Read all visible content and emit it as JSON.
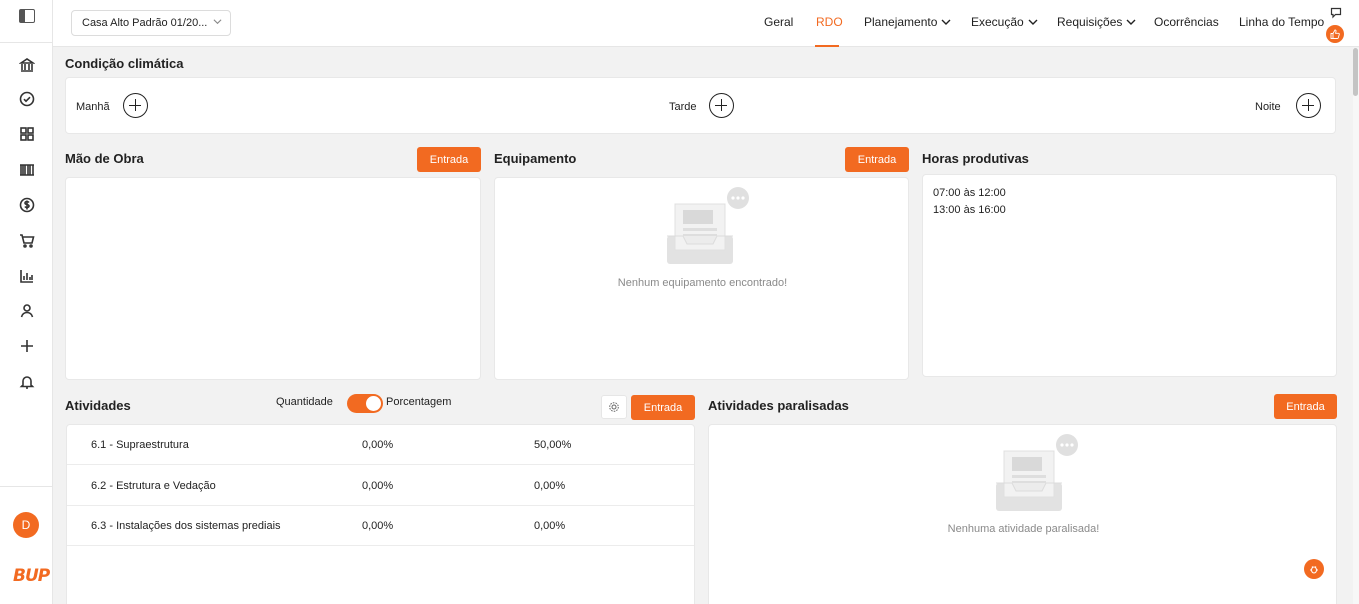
{
  "header": {
    "project": "Casa Alto Padrão 01/20...",
    "nav": {
      "geral": "Geral",
      "rdo": "RDO",
      "planejamento": "Planejamento",
      "execucao": "Execução",
      "requisicoes": "Requisições",
      "ocorrencias": "Ocorrências",
      "linha_do_tempo": "Linha do Tempo"
    }
  },
  "user": {
    "initial": "D"
  },
  "brand": {
    "logo": "BUP",
    "accent": "#f26a21"
  },
  "weather": {
    "title": "Condição climática",
    "manha": "Manhã",
    "tarde": "Tarde",
    "noite": "Noite"
  },
  "labor": {
    "title": "Mão de Obra",
    "button": "Entrada"
  },
  "equipment": {
    "title": "Equipamento",
    "button": "Entrada",
    "empty": "Nenhum equipamento encontrado!"
  },
  "hours": {
    "title": "Horas produtivas",
    "items": [
      "07:00 às 12:00",
      "13:00 às 16:00"
    ]
  },
  "activities": {
    "title": "Atividades",
    "toggle_left": "Quantidade",
    "toggle_right": "Porcentagem",
    "button": "Entrada",
    "rows": [
      {
        "name": "6.1 - Supraestrutura",
        "v1": "0,00%",
        "v2": "50,00%"
      },
      {
        "name": "6.2 - Estrutura e Vedação",
        "v1": "0,00%",
        "v2": "0,00%"
      },
      {
        "name": "6.3 - Instalações dos sistemas prediais",
        "v1": "0,00%",
        "v2": "0,00%"
      }
    ]
  },
  "paused": {
    "title": "Atividades paralisadas",
    "button": "Entrada",
    "empty": "Nenhuma atividade paralisada!"
  }
}
